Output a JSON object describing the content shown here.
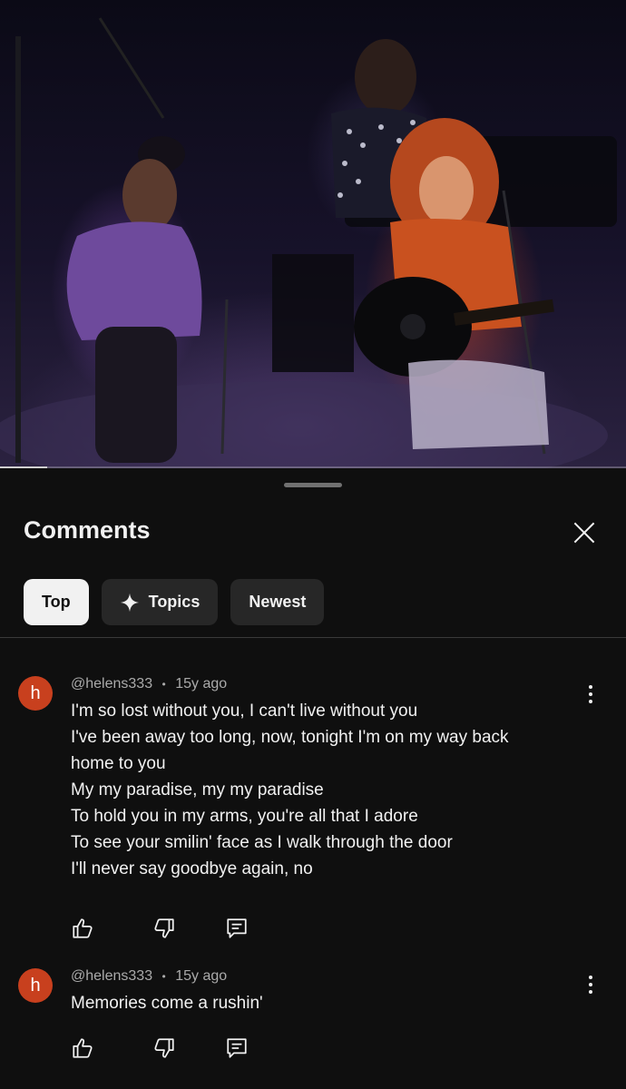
{
  "video": {
    "progress": 0.075
  },
  "sheet": {
    "title": "Comments",
    "close_icon": "close-icon"
  },
  "chips": [
    {
      "label": "Top",
      "active": true
    },
    {
      "label": "Topics",
      "icon": "sparkle-icon",
      "active": false
    },
    {
      "label": "Newest",
      "active": false
    }
  ],
  "comments": [
    {
      "avatar_letter": "h",
      "avatar_color": "#c8401e",
      "author": "@helens333",
      "separator": "•",
      "time": "15y ago",
      "lines": [
        "I'm so lost without you, I can't live without you",
        "I've been away too long, now, tonight I'm on my way back",
        "home to you",
        "My my paradise, my my paradise",
        "To hold you in my arms, you're all that I adore",
        "To see your smilin' face as I walk through the door",
        "I'll never say goodbye again, no"
      ]
    },
    {
      "avatar_letter": "h",
      "avatar_color": "#c8401e",
      "author": "@helens333",
      "separator": "•",
      "time": "15y ago",
      "lines": [
        "Memories come a rushin'"
      ]
    }
  ],
  "icons": {
    "like": "thumbs-up-icon",
    "dislike": "thumbs-down-icon",
    "reply": "reply-icon",
    "menu": "more-vert-icon"
  }
}
